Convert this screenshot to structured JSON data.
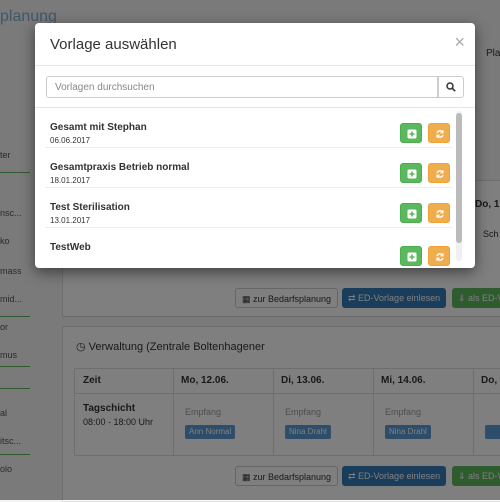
{
  "background": {
    "title_fragment": "planung",
    "right_labels": {
      "plan": "Pla",
      "do_col": "Do, 1",
      "schicht": "Sch"
    },
    "sidebar_items": [
      "ter",
      "nsc...",
      "ko",
      "mass",
      "mid...",
      "or",
      "mus",
      "al",
      "itsc...",
      "olo"
    ],
    "top_section_buttons": {
      "bedarf": "zur Bedarfsplanung",
      "ed_vorlage": "ED-Vorlage einlesen",
      "als_ed": "als ED-V"
    },
    "section": {
      "title": "Verwaltung (Zentrale Boltenhagener",
      "columns": [
        "Zeit",
        "Mo, 12.06.",
        "Di, 13.06.",
        "Mi, 14.06.",
        "Do, 1"
      ],
      "shift_name": "Tagschicht",
      "shift_time": "08:00 - 18:00 Uhr",
      "empfang_label": "Empfang",
      "tags": [
        "Ann Normal",
        "Nina Drahl",
        "Nina Drahl",
        ""
      ]
    },
    "bottom_buttons": {
      "bedarf": "zur Bedarfsplanung",
      "ed_vorlage": "ED-Vorlage einlesen",
      "als_ed": "als ED-Vo"
    }
  },
  "modal": {
    "title": "Vorlage auswählen",
    "close_symbol": "×",
    "search": {
      "placeholder": "Vorlagen durchsuchen"
    },
    "items": [
      {
        "name": "Gesamt mit Stephan",
        "date": "06.06.2017"
      },
      {
        "name": "Gesamtpraxis Betrieb normal",
        "date": "18.01.2017"
      },
      {
        "name": "Test Sterilisation",
        "date": "13.01.2017"
      },
      {
        "name": "TestWeb",
        "date": ""
      }
    ]
  },
  "colors": {
    "success": "#5cb85c",
    "warning": "#f0ad4e",
    "primary": "#337ab7"
  },
  "icons": {
    "search": "magnifier-icon",
    "add": "plus-square-icon",
    "refresh": "refresh-icon",
    "close": "close-icon"
  }
}
